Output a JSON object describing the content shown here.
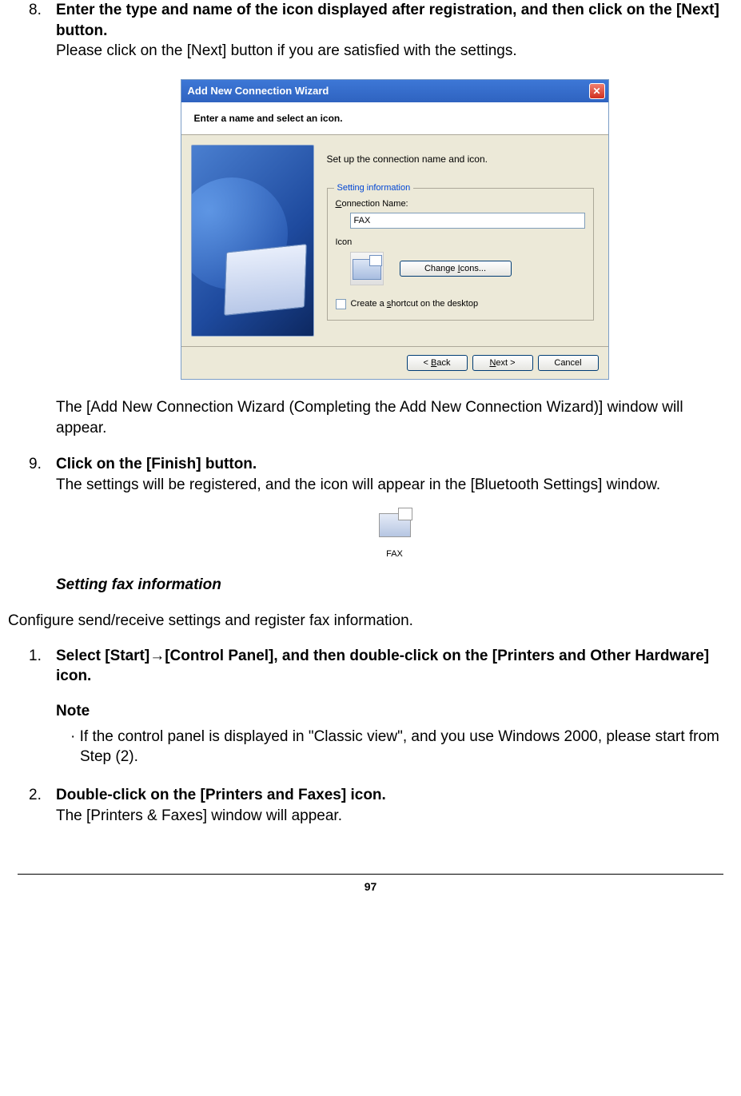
{
  "step8": {
    "number": "8.",
    "heading": "Enter the type and name of the icon displayed after registration, and then click on the [Next] button.",
    "body": "Please click on the [Next] button if you are satisfied with the settings."
  },
  "wizard": {
    "title": "Add New Connection Wizard",
    "banner": "Enter a name and select an icon.",
    "instruction": "Set up the connection name and icon.",
    "group_title": "Setting information",
    "conn_label_pre": "C",
    "conn_label_rest": "onnection Name:",
    "conn_value": "FAX",
    "icon_label": "Icon",
    "change_pre": "Change ",
    "change_u": "I",
    "change_post": "cons...",
    "shortcut_pre": "Create a ",
    "shortcut_u": "s",
    "shortcut_post": "hortcut on the desktop",
    "back_pre": "< ",
    "back_u": "B",
    "back_post": "ack",
    "next_u": "N",
    "next_post": "ext >",
    "cancel": "Cancel"
  },
  "after_wizard": "The [Add New Connection Wizard (Completing the Add New Connection Wizard)] window will appear.",
  "step9": {
    "number": "9.",
    "heading": "Click on the [Finish] button.",
    "body": "The settings will be registered, and the icon will appear in the [Bluetooth Settings] window."
  },
  "fax_icon_label": "FAX",
  "section_heading": "Setting fax information",
  "intro_para": "Configure send/receive settings and register fax information.",
  "step1": {
    "number": "1.",
    "heading_pre": "Select [Start]",
    "heading_arrow": "→",
    "heading_post": "[Control Panel], and then double-click on the [Printers and Other Hardware] icon.",
    "note_label": "Note",
    "note_marker": "· ",
    "note_body": "If the control panel is displayed in \"Classic view\", and you use Windows 2000, please start from Step (2)."
  },
  "step2": {
    "number": "2.",
    "heading": "Double-click on the [Printers and Faxes] icon.",
    "body": "The [Printers & Faxes] window will appear."
  },
  "page_number": "97"
}
